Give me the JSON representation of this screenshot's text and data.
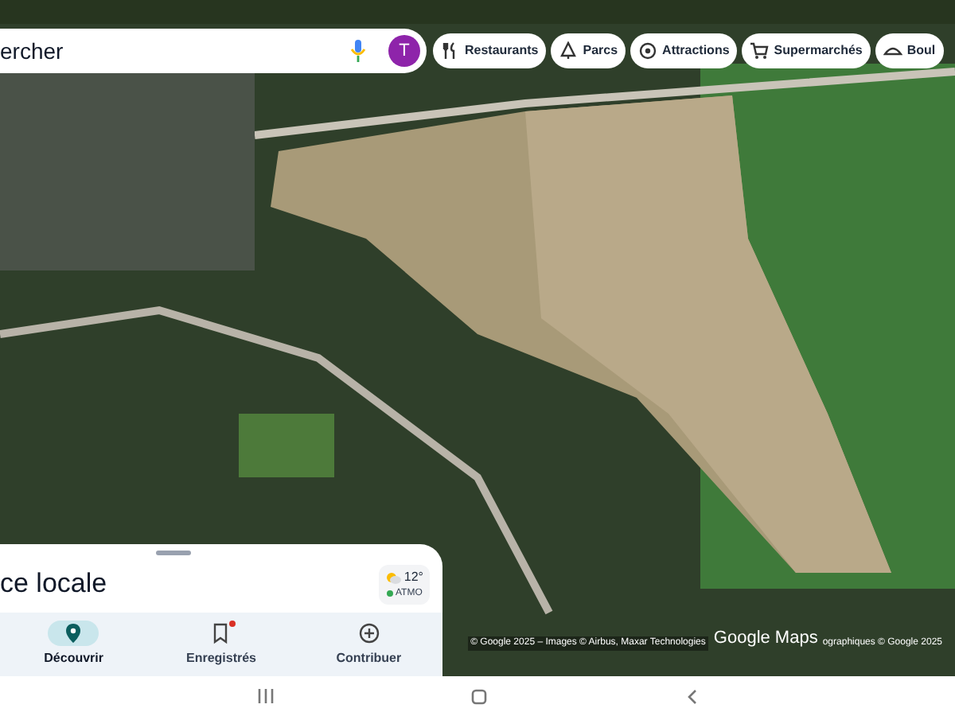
{
  "search": {
    "value": "ercher"
  },
  "chips": [
    {
      "label": "Restaurants",
      "kind": "restaurant"
    },
    {
      "label": "Parcs",
      "kind": "park"
    },
    {
      "label": "Attractions",
      "kind": "attraction"
    },
    {
      "label": "Supermarchés",
      "kind": "cart"
    },
    {
      "label": "Boul",
      "kind": "bakery"
    }
  ],
  "attribution": {
    "left": "© Google 2025 – Images © Airbus, Maxar Technologies",
    "logo": "Google Maps",
    "right": "ographiques © Google 2025"
  },
  "sheet": {
    "title": "ce locale",
    "weather": {
      "temperature": "12°",
      "air_quality": "ATMO",
      "color": "#34a853"
    },
    "tabs": [
      {
        "label": "Découvrir",
        "kind": "pin",
        "selected": true,
        "badge": false
      },
      {
        "label": "Enregistrés",
        "kind": "bookmark",
        "selected": false,
        "badge": true
      },
      {
        "label": "Contribuer",
        "kind": "plus",
        "selected": false,
        "badge": false
      }
    ]
  },
  "avatar": {
    "letter": "T"
  }
}
